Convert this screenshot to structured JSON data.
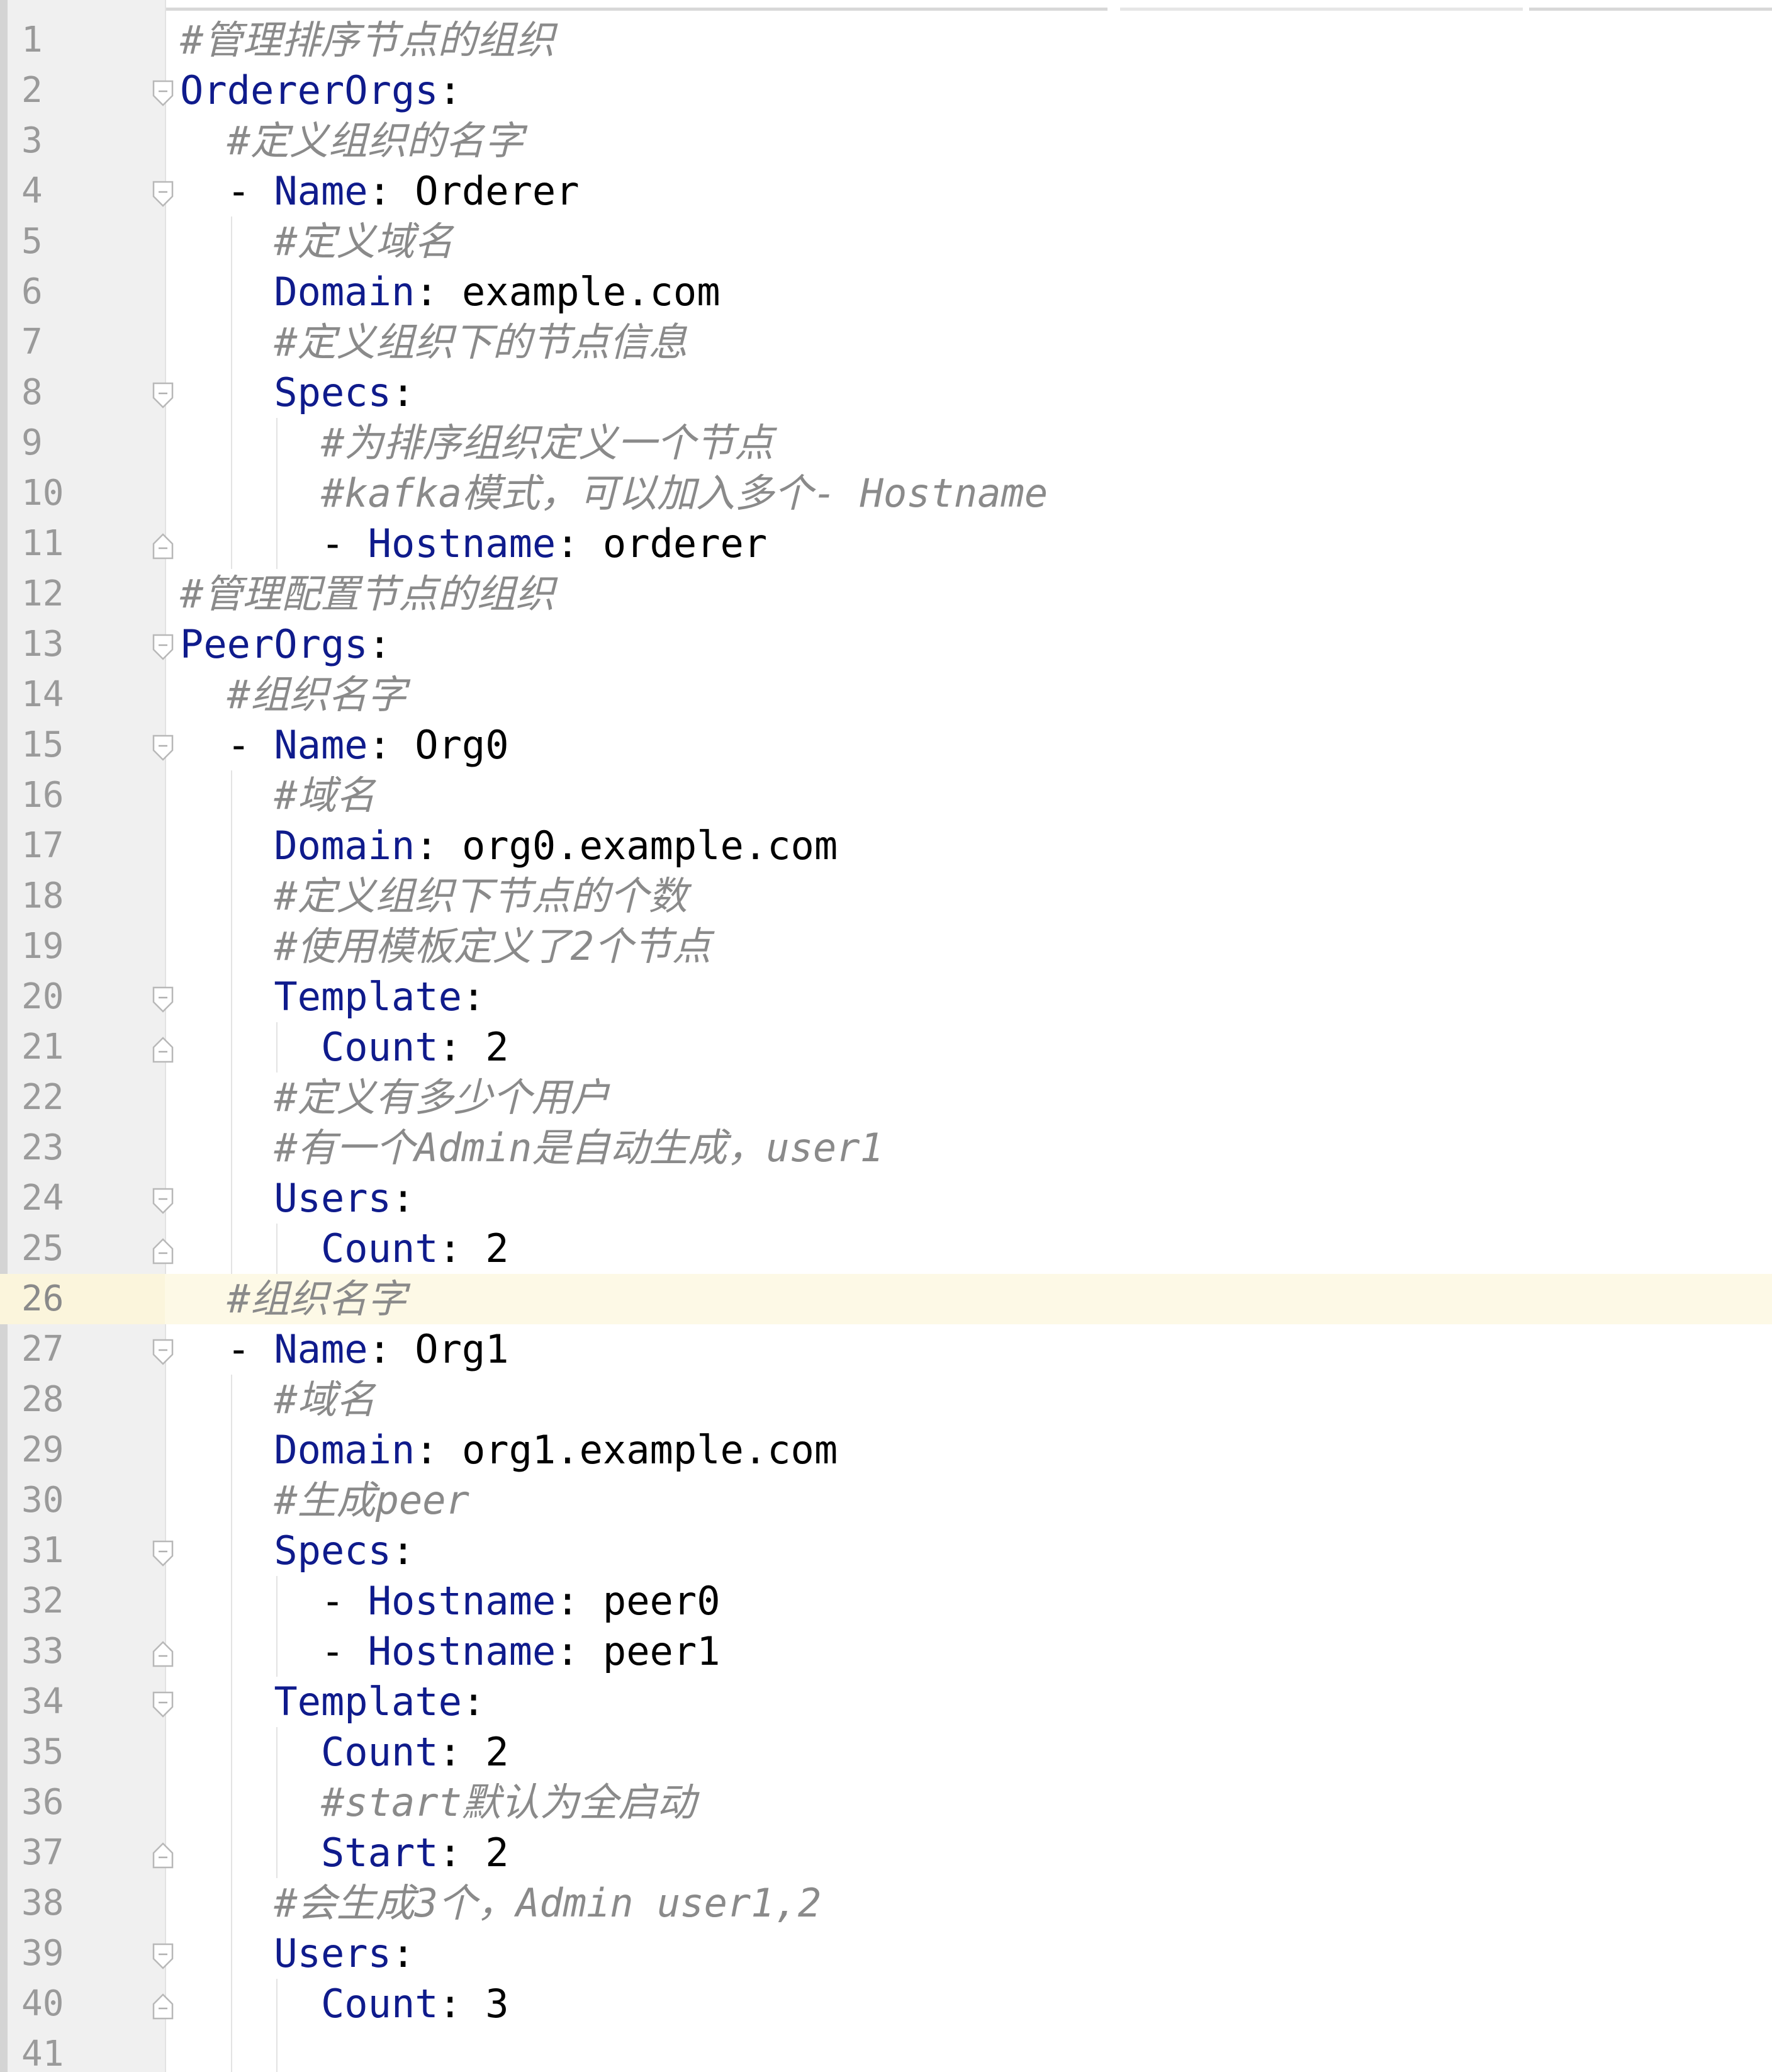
{
  "editor": {
    "language": "yaml",
    "current_line": 26,
    "lines": [
      {
        "num": "1",
        "indent": "",
        "comment": "#管理排序节点的组织",
        "fold": ""
      },
      {
        "num": "2",
        "indent": "",
        "key": "OrdererOrgs",
        "colon": ":",
        "fold": "start"
      },
      {
        "num": "3",
        "indent": "  ",
        "comment": "#定义组织的名字",
        "fold": ""
      },
      {
        "num": "4",
        "indent": "  ",
        "dash": "- ",
        "key": "Name",
        "colon": ": ",
        "value": "Orderer",
        "fold": "start"
      },
      {
        "num": "5",
        "indent": "    ",
        "comment": "#定义域名",
        "fold": ""
      },
      {
        "num": "6",
        "indent": "    ",
        "key": "Domain",
        "colon": ": ",
        "value": "example.com",
        "fold": ""
      },
      {
        "num": "7",
        "indent": "    ",
        "comment": "#定义组织下的节点信息",
        "fold": ""
      },
      {
        "num": "8",
        "indent": "    ",
        "key": "Specs",
        "colon": ":",
        "fold": "start"
      },
      {
        "num": "9",
        "indent": "      ",
        "comment": "#为排序组织定义一个节点",
        "fold": ""
      },
      {
        "num": "10",
        "indent": "      ",
        "comment": "#kafka模式，可以加入多个- Hostname",
        "fold": ""
      },
      {
        "num": "11",
        "indent": "      ",
        "dash": "- ",
        "key": "Hostname",
        "colon": ": ",
        "value": "orderer",
        "fold": "end"
      },
      {
        "num": "12",
        "indent": "",
        "comment": "#管理配置节点的组织",
        "fold": ""
      },
      {
        "num": "13",
        "indent": "",
        "key": "PeerOrgs",
        "colon": ":",
        "fold": "start"
      },
      {
        "num": "14",
        "indent": "  ",
        "comment": "#组织名字",
        "fold": ""
      },
      {
        "num": "15",
        "indent": "  ",
        "dash": "- ",
        "key": "Name",
        "colon": ": ",
        "value": "Org0",
        "fold": "start"
      },
      {
        "num": "16",
        "indent": "    ",
        "comment": "#域名",
        "fold": ""
      },
      {
        "num": "17",
        "indent": "    ",
        "key": "Domain",
        "colon": ": ",
        "value": "org0.example.com",
        "fold": ""
      },
      {
        "num": "18",
        "indent": "    ",
        "comment": "#定义组织下节点的个数",
        "fold": ""
      },
      {
        "num": "19",
        "indent": "    ",
        "comment": "#使用模板定义了2个节点",
        "fold": ""
      },
      {
        "num": "20",
        "indent": "    ",
        "key": "Template",
        "colon": ":",
        "fold": "start"
      },
      {
        "num": "21",
        "indent": "      ",
        "key": "Count",
        "colon": ": ",
        "value": "2",
        "fold": "end"
      },
      {
        "num": "22",
        "indent": "    ",
        "comment": "#定义有多少个用户",
        "fold": ""
      },
      {
        "num": "23",
        "indent": "    ",
        "comment": "#有一个Admin是自动生成，user1",
        "fold": ""
      },
      {
        "num": "24",
        "indent": "    ",
        "key": "Users",
        "colon": ":",
        "fold": "start"
      },
      {
        "num": "25",
        "indent": "      ",
        "key": "Count",
        "colon": ": ",
        "value": "2",
        "fold": "end"
      },
      {
        "num": "26",
        "indent": "  ",
        "comment": "#组织名字",
        "fold": ""
      },
      {
        "num": "27",
        "indent": "  ",
        "dash": "- ",
        "key": "Name",
        "colon": ": ",
        "value": "Org1",
        "fold": "start"
      },
      {
        "num": "28",
        "indent": "    ",
        "comment": "#域名",
        "fold": ""
      },
      {
        "num": "29",
        "indent": "    ",
        "key": "Domain",
        "colon": ": ",
        "value": "org1.example.com",
        "fold": ""
      },
      {
        "num": "30",
        "indent": "    ",
        "comment": "#生成peer",
        "fold": ""
      },
      {
        "num": "31",
        "indent": "    ",
        "key": "Specs",
        "colon": ":",
        "fold": "start"
      },
      {
        "num": "32",
        "indent": "      ",
        "dash": "- ",
        "key": "Hostname",
        "colon": ": ",
        "value": "peer0",
        "fold": ""
      },
      {
        "num": "33",
        "indent": "      ",
        "dash": "- ",
        "key": "Hostname",
        "colon": ": ",
        "value": "peer1",
        "fold": "end"
      },
      {
        "num": "34",
        "indent": "    ",
        "key": "Template",
        "colon": ":",
        "fold": "start"
      },
      {
        "num": "35",
        "indent": "      ",
        "key": "Count",
        "colon": ": ",
        "value": "2",
        "fold": ""
      },
      {
        "num": "36",
        "indent": "      ",
        "comment": "#start默认为全启动",
        "fold": ""
      },
      {
        "num": "37",
        "indent": "      ",
        "key": "Start",
        "colon": ": ",
        "value": "2",
        "fold": "end"
      },
      {
        "num": "38",
        "indent": "    ",
        "comment": "#会生成3个，Admin user1,2",
        "fold": ""
      },
      {
        "num": "39",
        "indent": "    ",
        "key": "Users",
        "colon": ":",
        "fold": "start"
      },
      {
        "num": "40",
        "indent": "      ",
        "key": "Count",
        "colon": ": ",
        "value": "3",
        "fold": "end"
      },
      {
        "num": "41",
        "indent": "",
        "fold": ""
      }
    ]
  }
}
